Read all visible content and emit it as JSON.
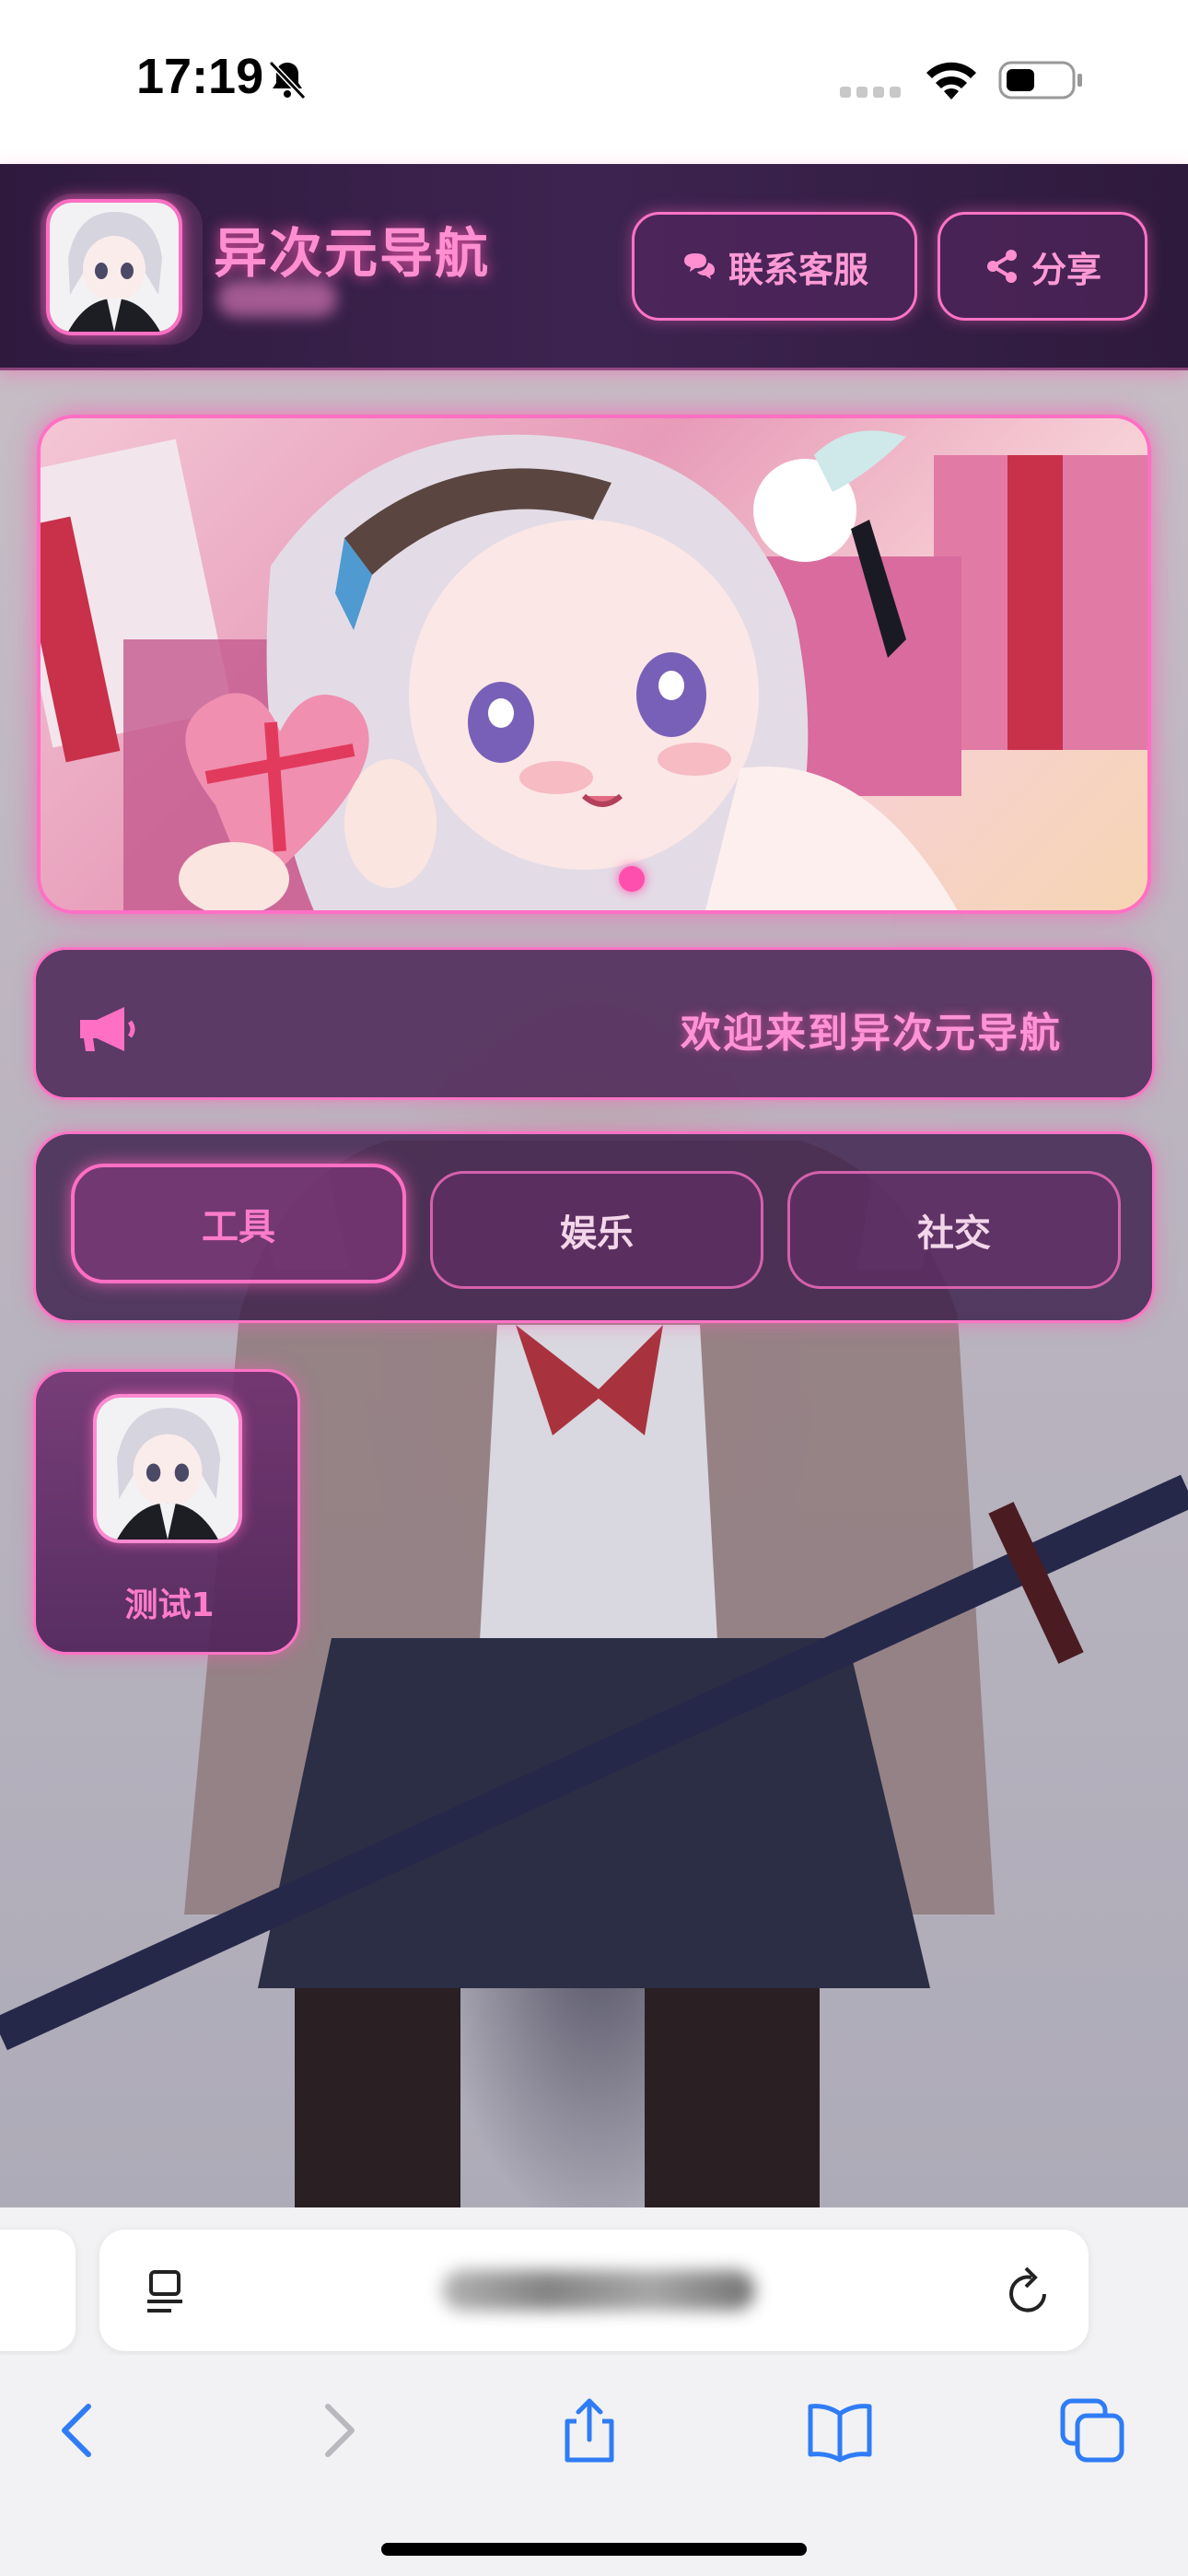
{
  "status_bar": {
    "time": "17:19",
    "icons": [
      "bell-slash-icon",
      "signal-icon",
      "wifi-icon",
      "battery-icon"
    ]
  },
  "header": {
    "title": "异次元导航",
    "contact_label": "联系客服",
    "share_label": "分享",
    "contact_icon": "chat-bubbles-icon",
    "share_icon": "share-nodes-icon",
    "accent_color": "#ff6fc4",
    "background_color": "#2f1a3e"
  },
  "notice": {
    "text": "欢迎来到异次元导航",
    "icon": "megaphone-icon"
  },
  "tabs": [
    {
      "label": "工具",
      "active": true
    },
    {
      "label": "娱乐",
      "active": false
    },
    {
      "label": "社交",
      "active": false
    }
  ],
  "sites": [
    {
      "label": "测试1",
      "icon": "anime-avatar"
    }
  ],
  "browser": {
    "toolbar_icons": [
      "back-icon",
      "forward-icon",
      "share-icon",
      "bookmarks-icon",
      "tabs-icon"
    ]
  }
}
